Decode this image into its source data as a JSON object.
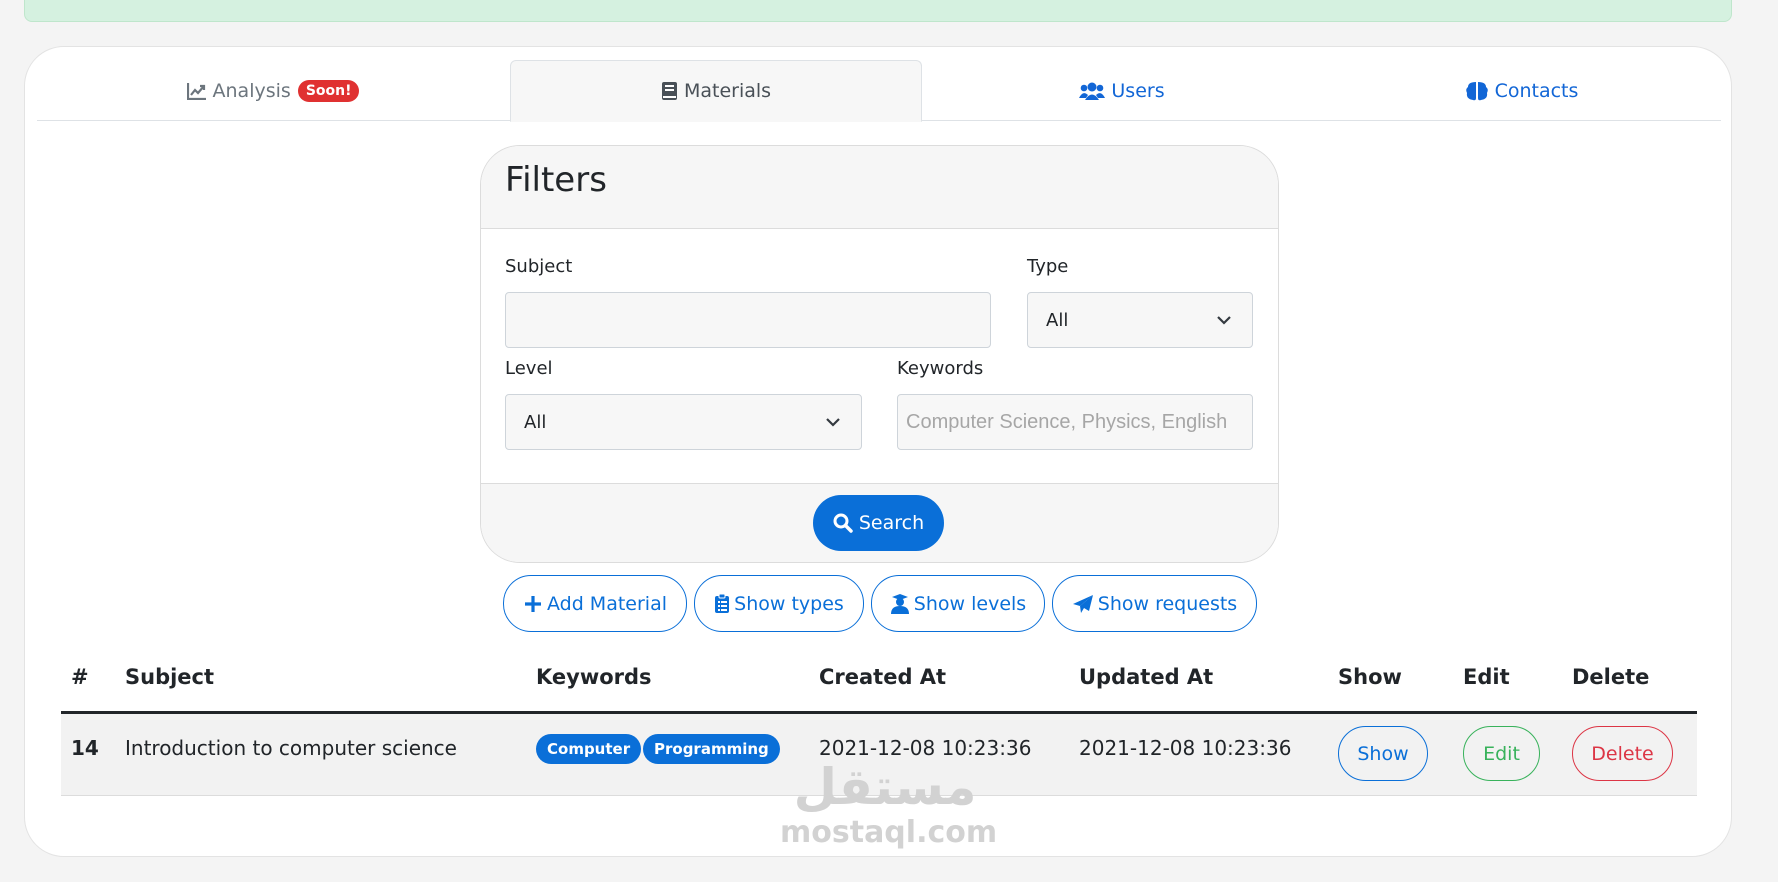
{
  "tabs": [
    {
      "label": "Analysis",
      "icon": "chart-line-icon",
      "badge": "Soon!"
    },
    {
      "label": "Materials",
      "icon": "book-icon"
    },
    {
      "label": "Users",
      "icon": "users-icon"
    },
    {
      "label": "Contacts",
      "icon": "brain-icon"
    }
  ],
  "filters": {
    "title": "Filters",
    "subject_label": "Subject",
    "subject_value": "",
    "type_label": "Type",
    "type_value": "All",
    "level_label": "Level",
    "level_value": "All",
    "keywords_label": "Keywords",
    "keywords_placeholder": "Computer Science, Physics, English",
    "search_label": "Search"
  },
  "actions": [
    {
      "label": "Add Material",
      "icon": "plus-icon"
    },
    {
      "label": "Show types",
      "icon": "clipboard-list-icon"
    },
    {
      "label": "Show levels",
      "icon": "user-graduate-icon"
    },
    {
      "label": "Show requests",
      "icon": "paper-plane-icon"
    }
  ],
  "table": {
    "headers": [
      "#",
      "Subject",
      "Keywords",
      "Created At",
      "Updated At",
      "Show",
      "Edit",
      "Delete"
    ],
    "rows": [
      {
        "id": "14",
        "subject": "Introduction to computer science",
        "keywords": [
          "Computer",
          "Programming"
        ],
        "created_at": "2021-12-08 10:23:36",
        "updated_at": "2021-12-08 10:23:36",
        "show": "Show",
        "edit": "Edit",
        "delete": "Delete"
      }
    ]
  },
  "watermark": {
    "arabic": "مستقل",
    "latin": "mostaql.com"
  },
  "colors": {
    "primary": "#0a6fd8",
    "success": "#38b25b",
    "danger": "#dc3545",
    "alert_bg": "#d5f1e0"
  }
}
